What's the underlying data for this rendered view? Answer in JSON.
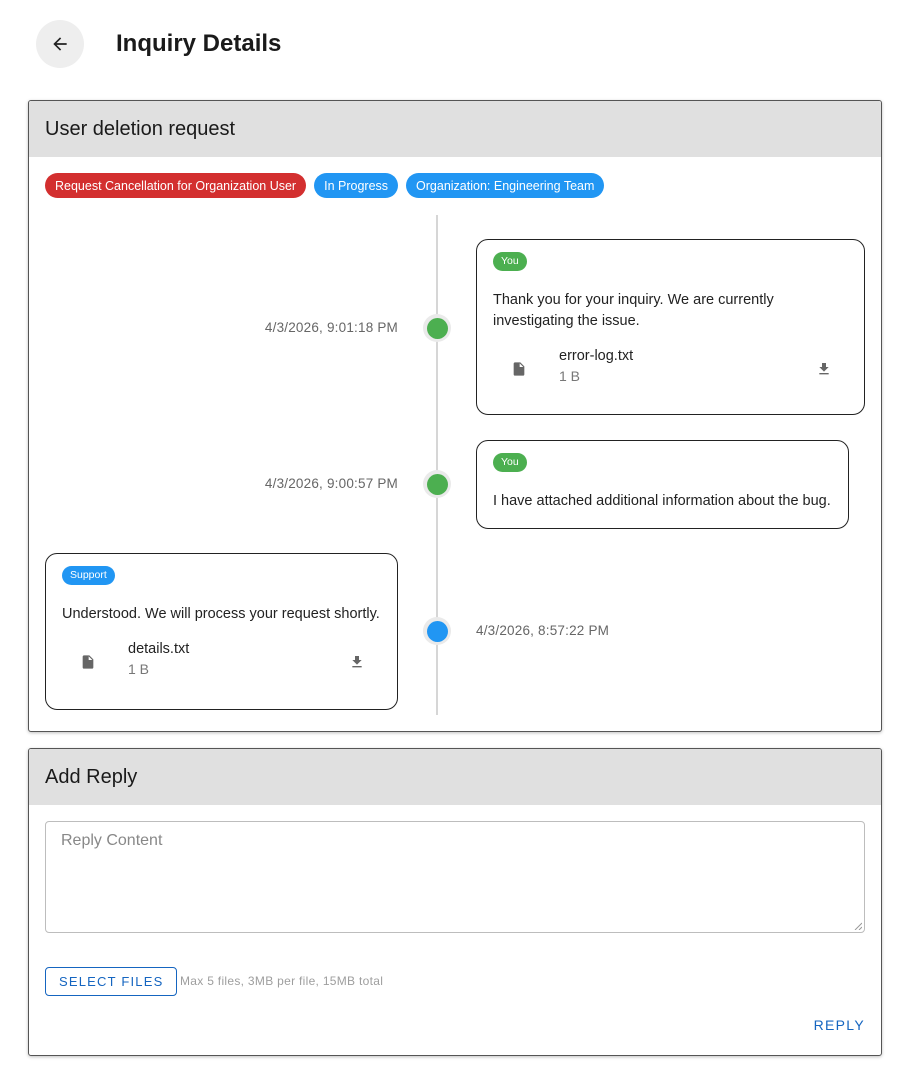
{
  "header": {
    "back_icon": "arrow-back-icon",
    "title": "Inquiry Details"
  },
  "inquiry": {
    "subject": "User deletion request",
    "chips": [
      {
        "label": "Request Cancellation for Organization User",
        "color": "#d32f2f"
      },
      {
        "label": "In Progress",
        "color": "#2196f3"
      },
      {
        "label": "Organization: Engineering Team",
        "color": "#2196f3"
      }
    ],
    "messages": [
      {
        "author": "You",
        "timestamp": "4/3/2026, 9:01:18 PM",
        "text": "Thank you for your inquiry. We are currently investigating the issue.",
        "attachment": {
          "name": "error-log.txt",
          "size": "1 B",
          "icon": "file-icon",
          "action_icon": "download-icon"
        }
      },
      {
        "author": "You",
        "timestamp": "4/3/2026, 9:00:57 PM",
        "text": "I have attached additional information about the bug."
      },
      {
        "author": "Support",
        "timestamp": "4/3/2026, 8:57:22 PM",
        "text": "Understood. We will process your request shortly.",
        "attachment": {
          "name": "details.txt",
          "size": "1 B",
          "icon": "file-icon",
          "action_icon": "download-icon"
        }
      }
    ]
  },
  "reply": {
    "title": "Add Reply",
    "placeholder": "Reply Content",
    "select_files_label": "SELECT FILES",
    "file_hint": "Max 5 files, 3MB per file, 15MB total",
    "submit_label": "REPLY"
  },
  "colors": {
    "user": "#4caf50",
    "support": "#2196f3",
    "accent": "#1565c0",
    "danger": "#d32f2f"
  }
}
